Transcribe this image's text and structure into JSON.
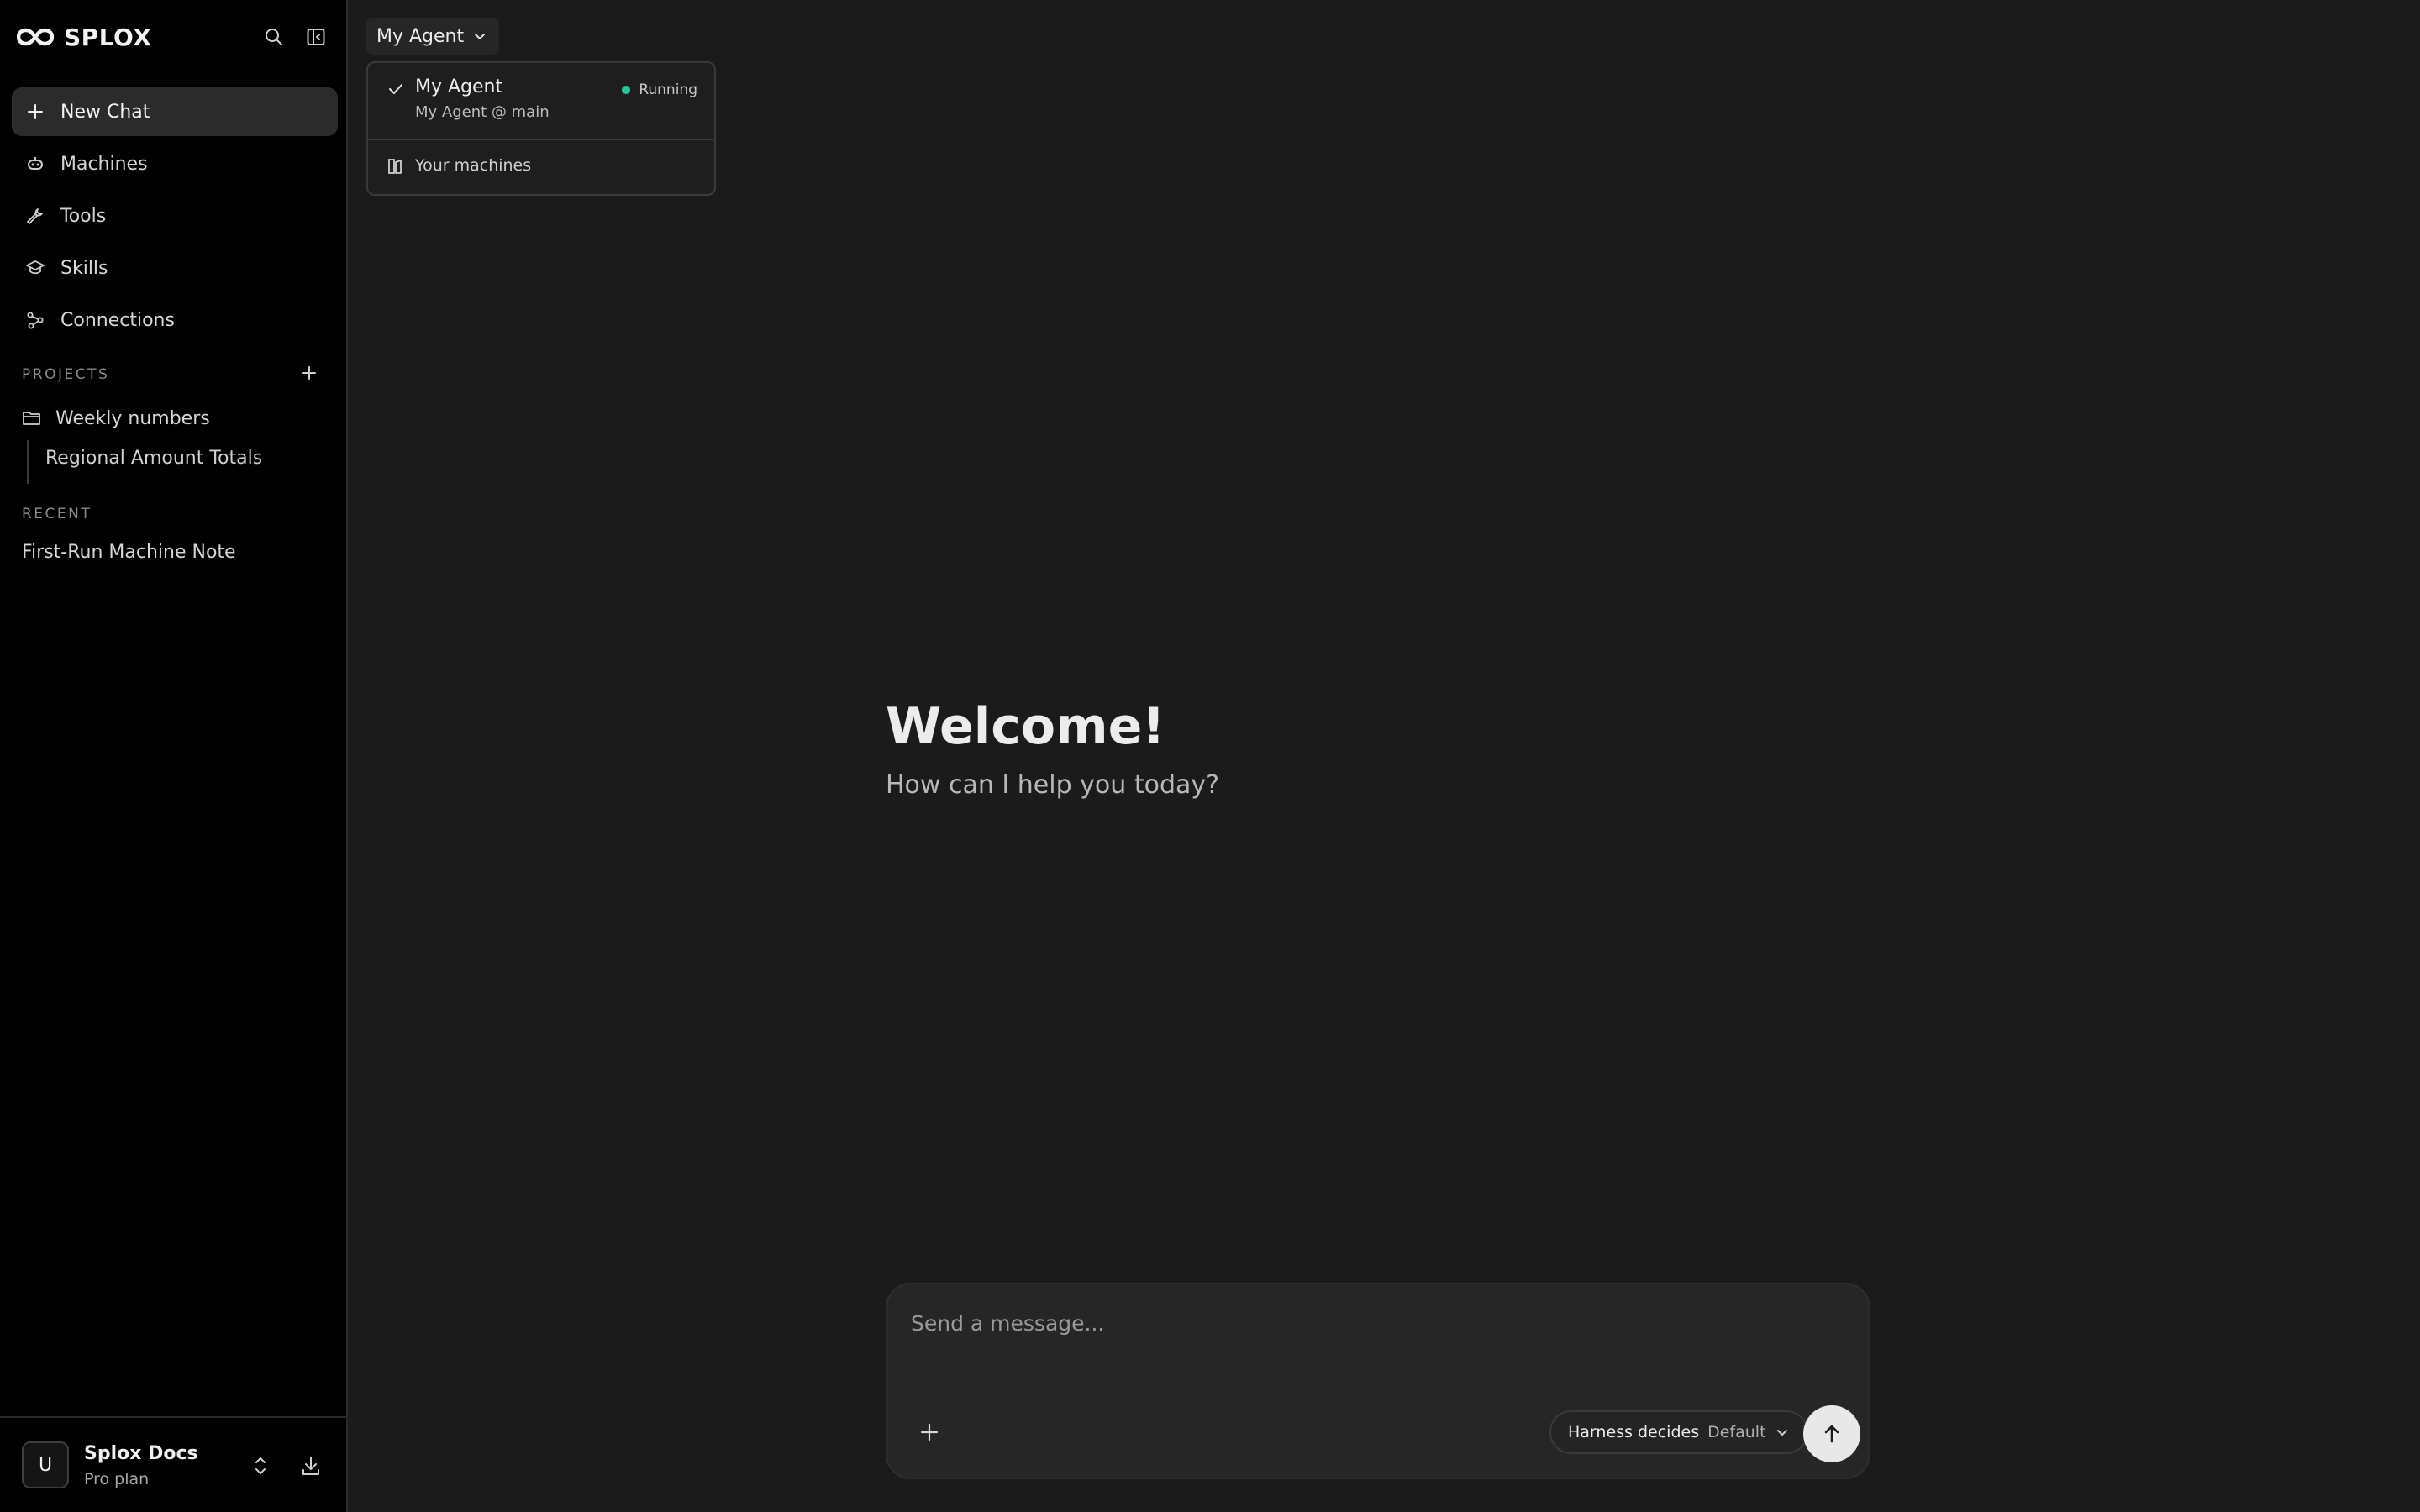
{
  "brand": {
    "name": "SPLOX"
  },
  "sidebar": {
    "nav": [
      {
        "label": "New Chat",
        "icon": "plus-icon"
      },
      {
        "label": "Machines",
        "icon": "robot-icon"
      },
      {
        "label": "Tools",
        "icon": "wrench-icon"
      },
      {
        "label": "Skills",
        "icon": "graduation-cap-icon"
      },
      {
        "label": "Connections",
        "icon": "connections-icon"
      }
    ],
    "projects_label": "PROJECTS",
    "project": {
      "name": "Weekly numbers",
      "child": "Regional Amount Totals"
    },
    "recent_label": "RECENT",
    "recent": [
      "First-Run Machine Note"
    ]
  },
  "account": {
    "initial": "U",
    "name": "Splox Docs",
    "plan": "Pro plan"
  },
  "agent_selector": {
    "label": "My Agent",
    "options": [
      {
        "name": "My Agent",
        "subtitle": "My Agent @ main",
        "status": "Running",
        "selected": true
      }
    ],
    "footer_item": "Your machines"
  },
  "welcome": {
    "title": "Welcome!",
    "subtitle": "How can I help you today?"
  },
  "composer": {
    "placeholder": "Send a message...",
    "harness_label": "Harness decides",
    "harness_value": "Default"
  },
  "colors": {
    "status_running": "#20c997",
    "sidebar_bg": "#000000",
    "main_bg": "#1b1b1b"
  }
}
